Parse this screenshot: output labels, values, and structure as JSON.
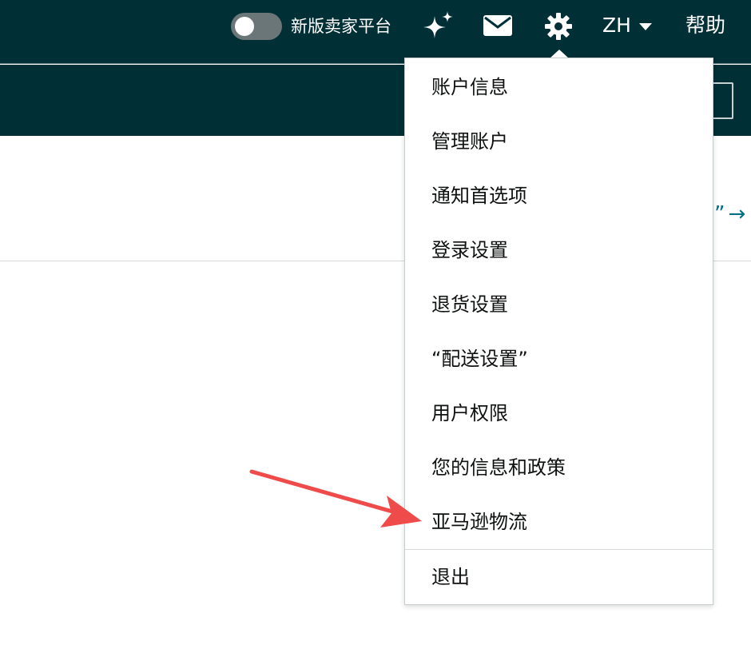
{
  "topbar": {
    "toggle_label": "新版卖家平台",
    "icons": [
      "sparkle-icon",
      "mail-icon",
      "gear-icon",
      "chevron-down-icon"
    ],
    "language": "ZH",
    "help": "帮助"
  },
  "content": {
    "link_text": "行”",
    "link_arrow": "→"
  },
  "menu": {
    "items": [
      "账户信息",
      "管理账户",
      "通知首选项",
      "登录设置",
      "退货设置",
      "“配送设置”",
      "用户权限",
      "您的信息和政策",
      "亚马逊物流"
    ],
    "signout": "退出"
  },
  "colors": {
    "nav_bg": "#002f36",
    "annotation_arrow": "#f04b4b",
    "link": "#007185"
  }
}
